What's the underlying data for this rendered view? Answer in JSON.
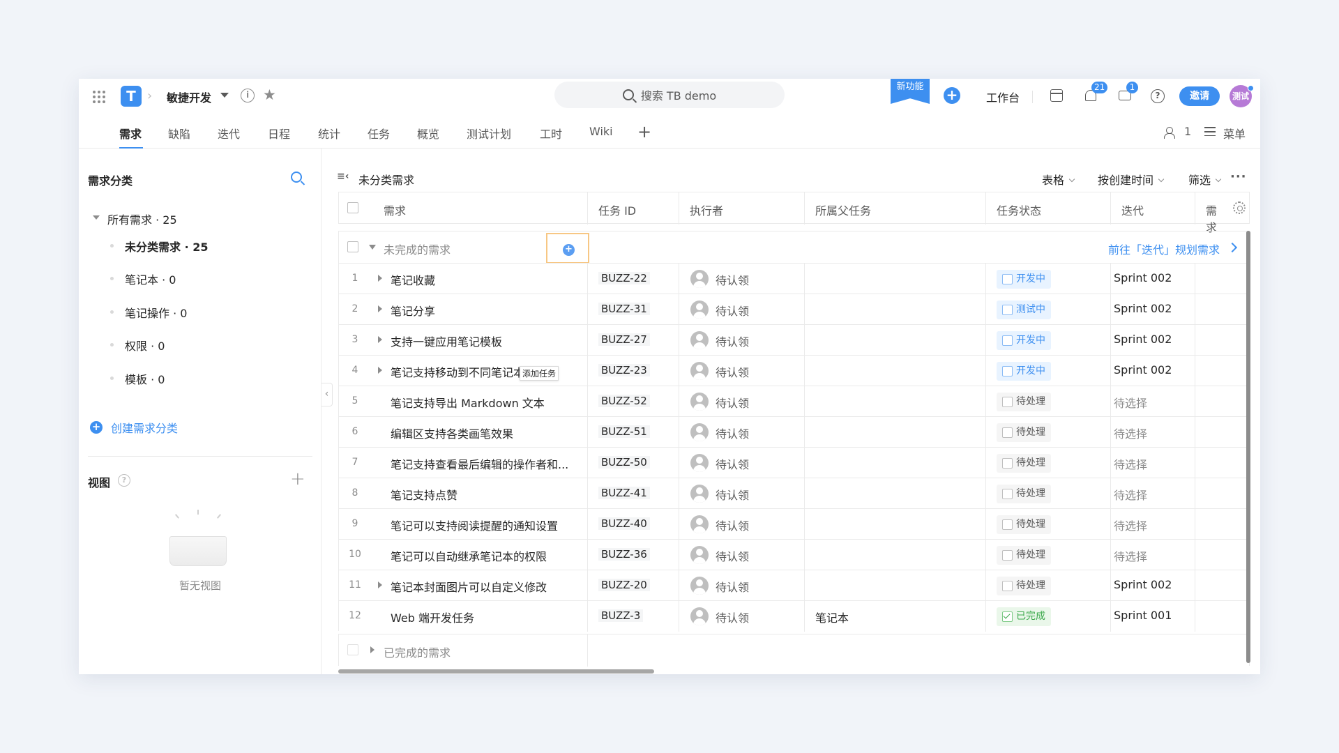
{
  "header": {
    "project_name": "敏捷开发",
    "search_placeholder": "搜索 TB demo",
    "new_feature": "新功能",
    "workbench": "工作台",
    "notification_count": "21",
    "message_count": "1",
    "invite": "邀请",
    "avatar_text": "测试",
    "brand_color": "#3d8ff0"
  },
  "tabs": [
    "需求",
    "缺陷",
    "迭代",
    "日程",
    "统计",
    "任务",
    "概览",
    "测试计划",
    "工时",
    "Wiki"
  ],
  "tabbar_right": {
    "member_count": "1",
    "menu": "菜单"
  },
  "sidebar": {
    "title": "需求分类",
    "root": "所有需求 · 25",
    "items": [
      "未分类需求 · 25",
      "笔记本 · 0",
      "笔记操作 · 0",
      "权限 · 0",
      "模板 · 0"
    ],
    "create": "创建需求分类",
    "view_title": "视图",
    "empty_view": "暂无视图"
  },
  "main": {
    "crumb_icon": "≡‹",
    "title": "未分类需求",
    "view_mode": "表格",
    "sort": "按创建时间",
    "filter": "筛选",
    "more": "···"
  },
  "table": {
    "columns": [
      "需求",
      "任务 ID",
      "执行者",
      "所属父任务",
      "任务状态",
      "迭代",
      "需求"
    ],
    "group_title": "未完成的需求",
    "add_task_tooltip": "添加任务",
    "plan_link": "前往「迭代」规划需求",
    "done_group": "已完成的需求",
    "rows": [
      {
        "num": "1",
        "title": "笔记收藏",
        "id": "BUZZ-22",
        "assignee": "待认领",
        "parent": "",
        "status": "开发中",
        "status_kind": "dev",
        "sprint": "Sprint 002",
        "has_children": true
      },
      {
        "num": "2",
        "title": "笔记分享",
        "id": "BUZZ-31",
        "assignee": "待认领",
        "parent": "",
        "status": "测试中",
        "status_kind": "dev",
        "sprint": "Sprint 002",
        "has_children": true
      },
      {
        "num": "3",
        "title": "支持一键应用笔记模板",
        "id": "BUZZ-27",
        "assignee": "待认领",
        "parent": "",
        "status": "开发中",
        "status_kind": "dev",
        "sprint": "Sprint 002",
        "has_children": true
      },
      {
        "num": "4",
        "title": "笔记支持移动到不同笔记本",
        "id": "BUZZ-23",
        "assignee": "待认领",
        "parent": "",
        "status": "开发中",
        "status_kind": "dev",
        "sprint": "Sprint 002",
        "has_children": true
      },
      {
        "num": "5",
        "title": "笔记支持导出 Markdown 文本",
        "id": "BUZZ-52",
        "assignee": "待认领",
        "parent": "",
        "status": "待处理",
        "status_kind": "todo",
        "sprint": "待选择",
        "has_children": false
      },
      {
        "num": "6",
        "title": "编辑区支持各类画笔效果",
        "id": "BUZZ-51",
        "assignee": "待认领",
        "parent": "",
        "status": "待处理",
        "status_kind": "todo",
        "sprint": "待选择",
        "has_children": false
      },
      {
        "num": "7",
        "title": "笔记支持查看最后编辑的操作者和...",
        "id": "BUZZ-50",
        "assignee": "待认领",
        "parent": "",
        "status": "待处理",
        "status_kind": "todo",
        "sprint": "待选择",
        "has_children": false
      },
      {
        "num": "8",
        "title": "笔记支持点赞",
        "id": "BUZZ-41",
        "assignee": "待认领",
        "parent": "",
        "status": "待处理",
        "status_kind": "todo",
        "sprint": "待选择",
        "has_children": false
      },
      {
        "num": "9",
        "title": "笔记可以支持阅读提醒的通知设置",
        "id": "BUZZ-40",
        "assignee": "待认领",
        "parent": "",
        "status": "待处理",
        "status_kind": "todo",
        "sprint": "待选择",
        "has_children": false
      },
      {
        "num": "10",
        "title": "笔记可以自动继承笔记本的权限",
        "id": "BUZZ-36",
        "assignee": "待认领",
        "parent": "",
        "status": "待处理",
        "status_kind": "todo",
        "sprint": "待选择",
        "has_children": false
      },
      {
        "num": "11",
        "title": "笔记本封面图片可以自定义修改",
        "id": "BUZZ-20",
        "assignee": "待认领",
        "parent": "",
        "status": "待处理",
        "status_kind": "todo",
        "sprint": "Sprint 002",
        "has_children": true
      },
      {
        "num": "12",
        "title": "Web 端开发任务",
        "id": "BUZZ-3",
        "assignee": "待认领",
        "parent": "笔记本",
        "status": "已完成",
        "status_kind": "done",
        "sprint": "Sprint 001",
        "has_children": false
      }
    ]
  }
}
